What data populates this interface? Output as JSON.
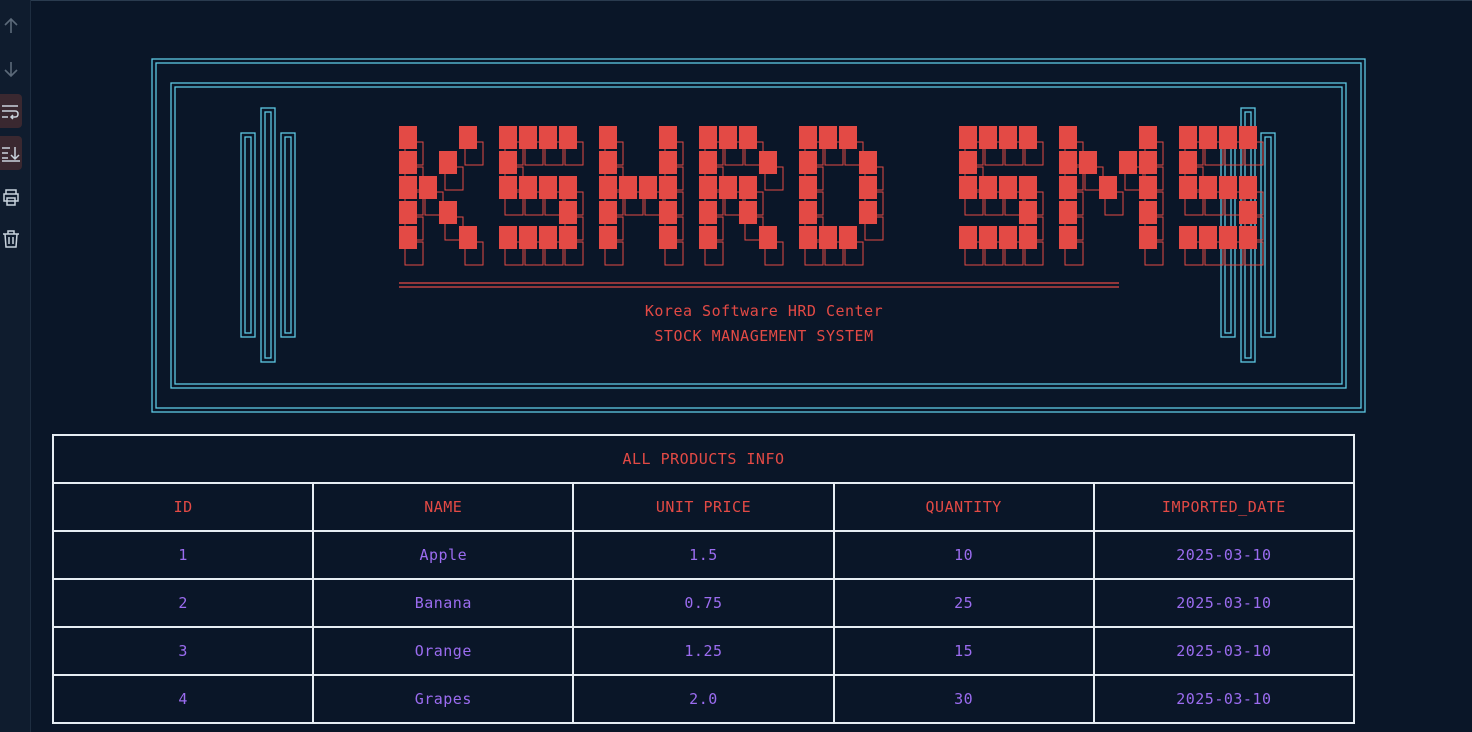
{
  "gutter": {
    "buttons": [
      {
        "name": "scroll-up-icon"
      },
      {
        "name": "scroll-down-icon"
      },
      {
        "name": "soft-wrap-icon"
      },
      {
        "name": "scroll-to-end-icon"
      },
      {
        "name": "print-icon"
      },
      {
        "name": "clear-all-icon"
      }
    ]
  },
  "banner": {
    "logo_text": "KSHRD SMS",
    "org_name": "Korea Software HRD Center",
    "system_name": "STOCK MANAGEMENT SYSTEM",
    "frame_color": "#5ec8e5",
    "logo_color": "#e34a45"
  },
  "products_table": {
    "caption": "ALL PRODUCTS INFO",
    "headers": [
      "ID",
      "NAME",
      "UNIT PRICE",
      "QUANTITY",
      "IMPORTED_DATE"
    ],
    "rows": [
      [
        "1",
        "Apple",
        "1.5",
        "10",
        "2025-03-10"
      ],
      [
        "2",
        "Banana",
        "0.75",
        "25",
        "2025-03-10"
      ],
      [
        "3",
        "Orange",
        "1.25",
        "15",
        "2025-03-10"
      ],
      [
        "4",
        "Grapes",
        "2.0",
        "30",
        "2025-03-10"
      ]
    ],
    "header_color": "#e34a45",
    "value_color": "#9b6cf0"
  }
}
